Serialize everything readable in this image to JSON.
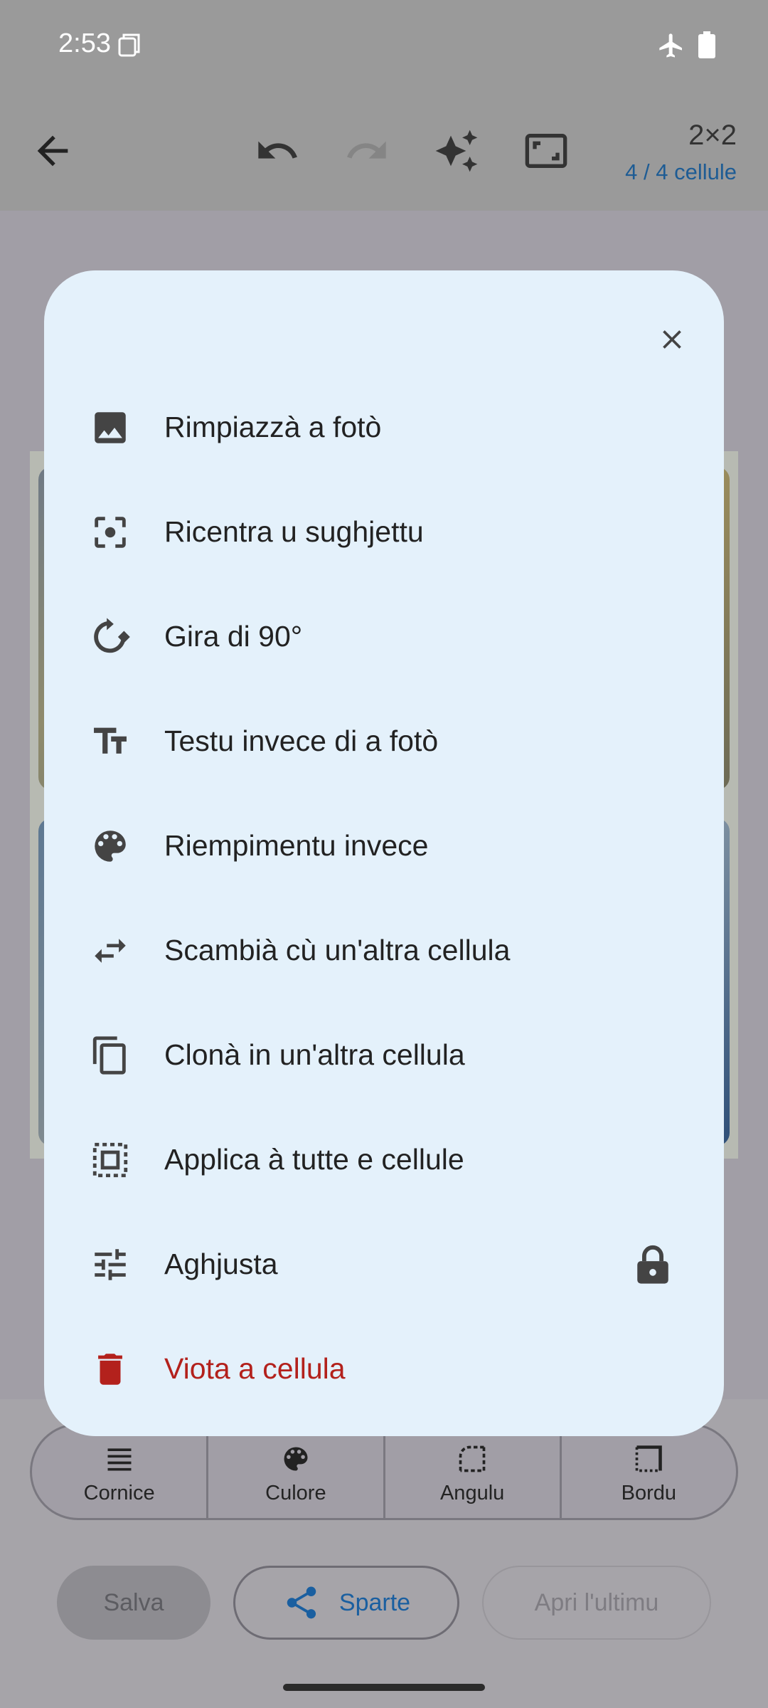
{
  "status": {
    "time": "2:53",
    "icons": [
      "screenshot-icon",
      "airplane-mode-icon",
      "battery-icon"
    ]
  },
  "toolbar": {
    "icons": [
      "back-arrow-icon",
      "undo-icon",
      "redo-icon",
      "sparkle-icon",
      "fullscreen-icon"
    ],
    "grid_size": "2×2",
    "cell_count": "4 / 4 cellule"
  },
  "dialog": {
    "close_icon": "close-icon",
    "items": [
      {
        "label": "Rimpiazzà a fotò",
        "icon": "image-icon"
      },
      {
        "label": "Ricentra u sughjettu",
        "icon": "center-focus-icon"
      },
      {
        "label": "Gira di 90°",
        "icon": "rotate-icon"
      },
      {
        "label": "Testu invece di a fotò",
        "icon": "text-fields-icon"
      },
      {
        "label": "Riempimentu invece",
        "icon": "palette-icon"
      },
      {
        "label": "Scambià cù un'altra cellula",
        "icon": "swap-icon"
      },
      {
        "label": "Clonà in un'altra cellula",
        "icon": "copy-icon"
      },
      {
        "label": "Applica à tutte e cellule",
        "icon": "select-all-icon"
      },
      {
        "label": "Aghjusta",
        "icon": "tune-icon",
        "trailing_icon": "lock-icon"
      },
      {
        "label": "Viota a cellula",
        "icon": "delete-icon",
        "color": "#b3211c"
      }
    ]
  },
  "segments": [
    {
      "label": "Cornice",
      "icon": "frame-lines-icon"
    },
    {
      "label": "Culore",
      "icon": "palette-icon"
    },
    {
      "label": "Angulu",
      "icon": "corner-icon"
    },
    {
      "label": "Bordu",
      "icon": "border-icon"
    }
  ],
  "actions": {
    "save": "Salva",
    "share": "Sparte",
    "open_last": "Apri l'ultimu"
  },
  "colors": {
    "dialog_bg": "#e4f1fb",
    "accent": "#1a5fa0",
    "danger": "#b3211c"
  }
}
